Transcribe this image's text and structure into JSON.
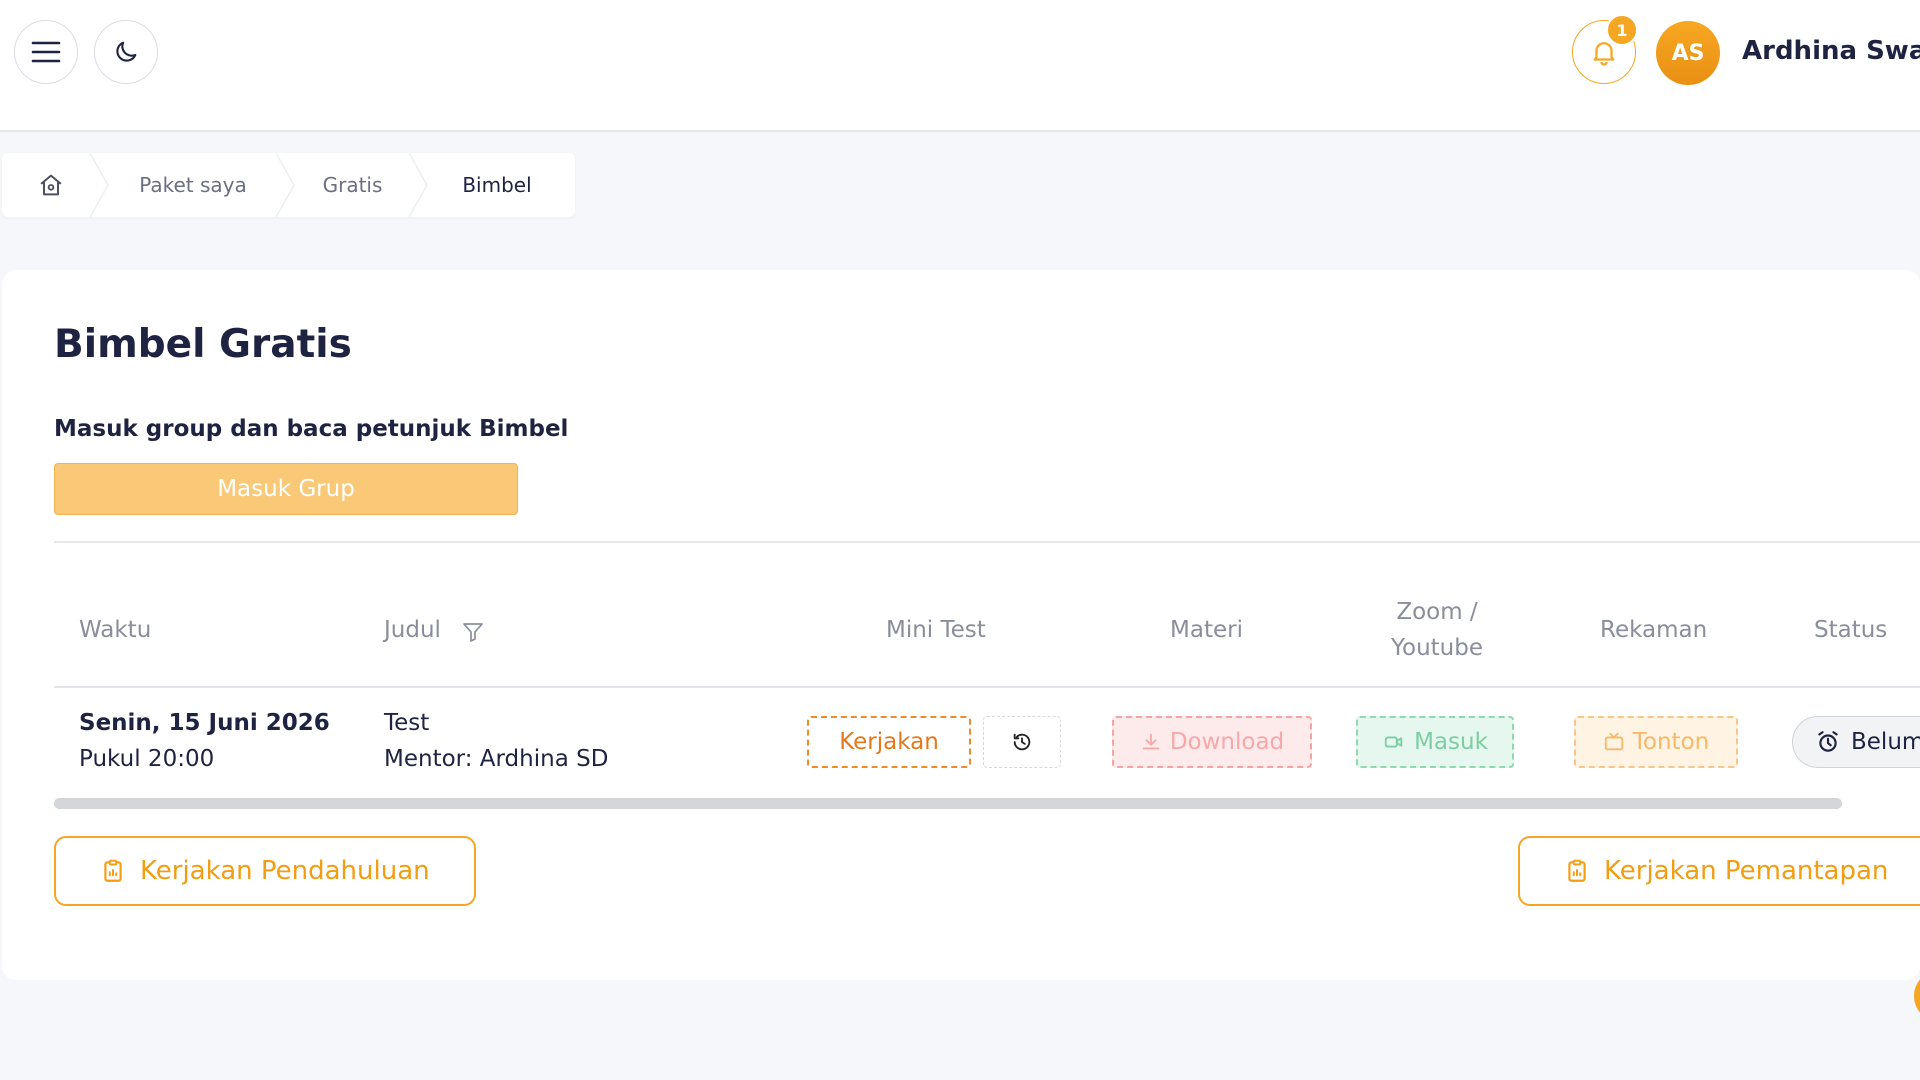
{
  "header": {
    "notification_count": "1",
    "avatar_initials": "AS",
    "user_name": "Ardhina Swad"
  },
  "breadcrumb": {
    "items": [
      "Paket saya",
      "Gratis",
      "Bimbel"
    ]
  },
  "page": {
    "title": "Bimbel Gratis",
    "subtitle": "Masuk group dan baca petunjuk Bimbel",
    "join_group_label": "Masuk Grup"
  },
  "table": {
    "headers": {
      "waktu": "Waktu",
      "judul": "Judul",
      "mini_test": "Mini Test",
      "materi": "Materi",
      "zoom_line1": "Zoom /",
      "zoom_line2": "Youtube",
      "rekaman": "Rekaman",
      "status": "Status"
    },
    "rows": [
      {
        "date": "Senin, 15 Juni 2026",
        "time": "Pukul 20:00",
        "title": "Test",
        "mentor": "Mentor: Ardhina SD",
        "mini_test_label": "Kerjakan",
        "materi_label": "Download",
        "zoom_label": "Masuk",
        "rekaman_label": "Tonton",
        "status_label": "Belum"
      }
    ]
  },
  "actions": {
    "pendahuluan_label": "Kerjakan Pendahuluan",
    "pemantapan_label": "Kerjakan Pemantapan"
  },
  "colors": {
    "accent": "#f5a623",
    "title_text": "#1f2342"
  }
}
